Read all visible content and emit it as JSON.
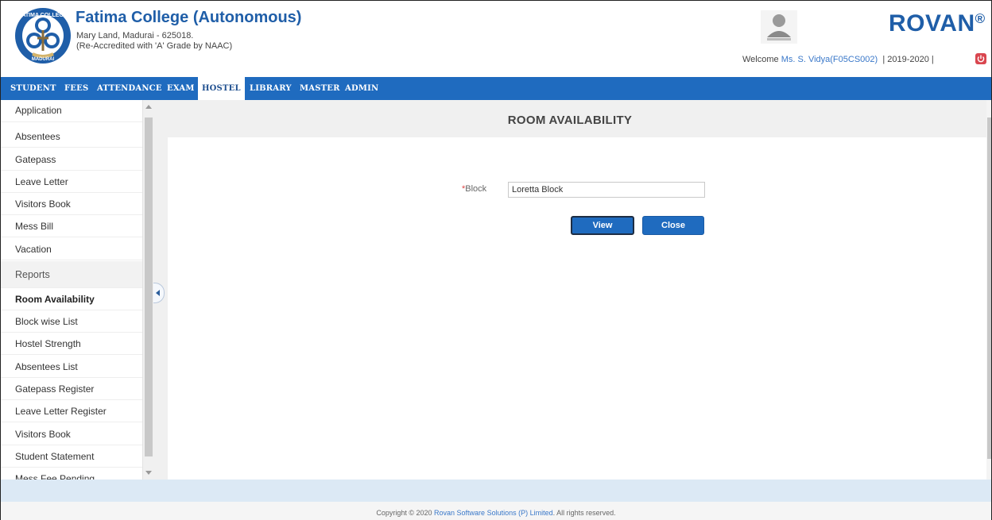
{
  "header": {
    "college_name": "Fatima College (Autonomous)",
    "address": "Mary Land, Madurai - 625018.",
    "accreditation": "(Re-Accredited with 'A' Grade by NAAC)",
    "logo_text_top": "FATIMA COLLEGE",
    "logo_text_bottom": "MADURAI",
    "brand": "ROVAN",
    "brand_mark": "®",
    "welcome_prefix": "Welcome",
    "welcome_user": "Ms. S. Vidya(F05CS002)",
    "separator_left": "|",
    "academic_year": "2019-2020",
    "separator_right": "|",
    "logout_icon": "power-icon"
  },
  "nav": {
    "items": [
      {
        "label": "STUDENT"
      },
      {
        "label": "FEES"
      },
      {
        "label": "ATTENDANCE"
      },
      {
        "label": "EXAM"
      },
      {
        "label": "HOSTEL"
      },
      {
        "label": "LIBRARY"
      },
      {
        "label": "MASTER"
      },
      {
        "label": "ADMIN"
      }
    ],
    "active": "HOSTEL"
  },
  "sidebar": {
    "items": [
      {
        "label": "Application"
      },
      {
        "label": "Absentees"
      },
      {
        "label": "Gatepass"
      },
      {
        "label": "Leave Letter"
      },
      {
        "label": "Visitors Book"
      },
      {
        "label": "Mess Bill"
      },
      {
        "label": "Vacation"
      }
    ],
    "reports_heading": "Reports",
    "reports": [
      {
        "label": "Room Availability"
      },
      {
        "label": "Block wise List"
      },
      {
        "label": "Hostel Strength"
      },
      {
        "label": "Absentees List"
      },
      {
        "label": "Gatepass Register"
      },
      {
        "label": "Leave Letter Register"
      },
      {
        "label": "Visitors Book"
      },
      {
        "label": "Student Statement"
      },
      {
        "label": "Mess Fee Pending"
      }
    ],
    "active": "Room Availability"
  },
  "main": {
    "title": "ROOM AVAILABILITY",
    "block_required_mark": "*",
    "block_label": "Block",
    "block_value": "Loretta Block",
    "view_button": "View",
    "close_button": "Close"
  },
  "footer": {
    "prefix": "Copyright © 2020 ",
    "company": "Rovan Software Solutions (P) Limited",
    "suffix": ". All rights reserved."
  },
  "colors": {
    "brand_blue": "#1f5ea8",
    "nav_blue": "#1f6bbf",
    "logout_red": "#d9464f",
    "link_blue": "#3a78c9"
  }
}
